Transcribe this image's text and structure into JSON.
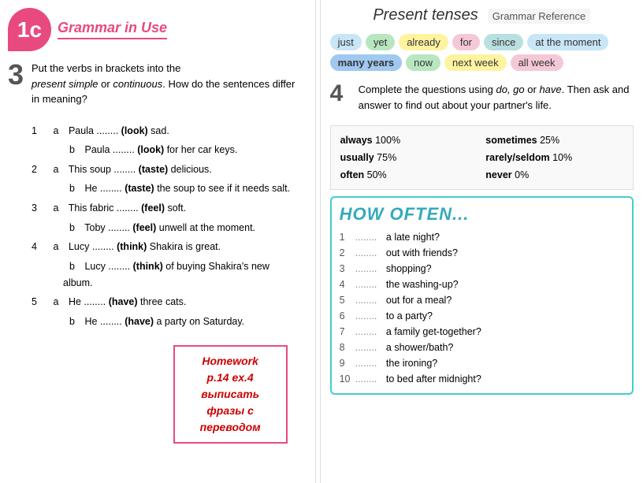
{
  "left": {
    "badge_letter": "1c",
    "badge_subtitle": "Grammar in Use",
    "section3_num": "3",
    "section3_intro": "Put the verbs in brackets into the",
    "section3_em1": "present simple",
    "section3_mid": " or ",
    "section3_em2": "continuous",
    "section3_end": ". How do the sentences differ in meaning?",
    "exercises": [
      {
        "num": "1",
        "parts": [
          {
            "letter": "a",
            "text": "Paula ........ (look) sad."
          },
          {
            "letter": "b",
            "text": "Paula ........ (look) for her car keys."
          }
        ]
      },
      {
        "num": "2",
        "parts": [
          {
            "letter": "a",
            "text": "This soup ........ (taste) delicious."
          },
          {
            "letter": "b",
            "text": "He ........ (taste) the soup to see if it needs salt."
          }
        ]
      },
      {
        "num": "3",
        "parts": [
          {
            "letter": "a",
            "text": "This fabric ........ (feel) soft."
          },
          {
            "letter": "b",
            "text": "Toby ........ (feel) unwell at the moment."
          }
        ]
      },
      {
        "num": "4",
        "parts": [
          {
            "letter": "a",
            "text": "Lucy ........ (think) Shakira is great."
          },
          {
            "letter": "b",
            "text": "Lucy ........ (think) of buying Shakira's new album."
          }
        ]
      },
      {
        "num": "5",
        "parts": [
          {
            "letter": "a",
            "text": "He ........ (have) three cats."
          },
          {
            "letter": "b",
            "text": "He ........ (have) a party on Saturday."
          }
        ]
      }
    ],
    "homework": {
      "line1": "Homework",
      "line2": "p.14 ex.4",
      "line3": "выписать",
      "line4": "фразы с",
      "line5": "переводом"
    }
  },
  "right": {
    "title": "Present tenses",
    "grammar_ref": "Grammar Reference",
    "tags": [
      {
        "text": "just",
        "color": "blue"
      },
      {
        "text": "yet",
        "color": "green"
      },
      {
        "text": "already",
        "color": "yellow"
      },
      {
        "text": "for",
        "color": "pink"
      },
      {
        "text": "since",
        "color": "teal"
      },
      {
        "text": "at the moment",
        "color": "blue"
      },
      {
        "text": "many years",
        "color": "highlight"
      },
      {
        "text": "now",
        "color": "green"
      },
      {
        "text": "next week",
        "color": "yellow"
      },
      {
        "text": "all week",
        "color": "pink"
      }
    ],
    "section4_num": "4",
    "section4_title": "Complete the questions using do, go or have. Then ask and answer to find out about your partner's life.",
    "frequency": [
      {
        "text": "always 100%",
        "bold": "always"
      },
      {
        "text": "sometimes 25%",
        "bold": "sometimes"
      },
      {
        "text": "usually 75%",
        "bold": "usually"
      },
      {
        "text": "rarely/seldom 10%",
        "bold": "rarely/seldom"
      },
      {
        "text": "often 50%",
        "bold": "often"
      },
      {
        "text": "never 0%",
        "bold": "never"
      }
    ],
    "how_often_title": "HOW OFTEN...",
    "how_often_items": [
      {
        "num": "1",
        "text": "........ a late night?"
      },
      {
        "num": "2",
        "text": "........ out with friends?"
      },
      {
        "num": "3",
        "text": "........ shopping?"
      },
      {
        "num": "4",
        "text": "........ the washing-up?"
      },
      {
        "num": "5",
        "text": "........ out for a meal?"
      },
      {
        "num": "6",
        "text": "........ to a party?"
      },
      {
        "num": "7",
        "text": "........ a family get-together?"
      },
      {
        "num": "8",
        "text": "........ a shower/bath?"
      },
      {
        "num": "9",
        "text": "........ the ironing?"
      },
      {
        "num": "10",
        "text": "........ to bed after midnight?"
      }
    ]
  }
}
